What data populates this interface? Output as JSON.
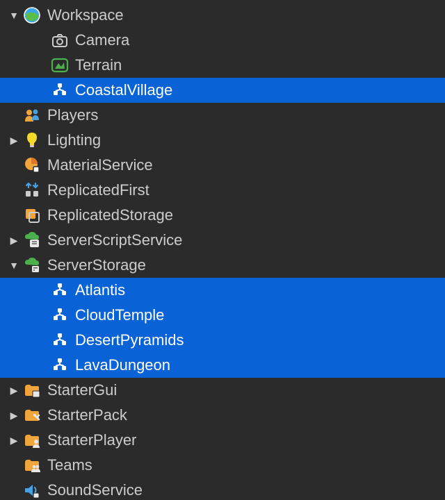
{
  "tree": {
    "workspace": {
      "label": "Workspace"
    },
    "camera": {
      "label": "Camera"
    },
    "terrain": {
      "label": "Terrain"
    },
    "coastal": {
      "label": "CoastalVillage"
    },
    "players": {
      "label": "Players"
    },
    "lighting": {
      "label": "Lighting"
    },
    "material": {
      "label": "MaterialService"
    },
    "repfirst": {
      "label": "ReplicatedFirst"
    },
    "repstorage": {
      "label": "ReplicatedStorage"
    },
    "sss": {
      "label": "ServerScriptService"
    },
    "serverstorage": {
      "label": "ServerStorage"
    },
    "atlantis": {
      "label": "Atlantis"
    },
    "cloudtemple": {
      "label": "CloudTemple"
    },
    "desert": {
      "label": "DesertPyramids"
    },
    "lava": {
      "label": "LavaDungeon"
    },
    "startergui": {
      "label": "StarterGui"
    },
    "starterpack": {
      "label": "StarterPack"
    },
    "starterplayer": {
      "label": "StarterPlayer"
    },
    "teams": {
      "label": "Teams"
    },
    "soundservice": {
      "label": "SoundService"
    }
  },
  "colors": {
    "selected": "#0a63d6",
    "background": "#2b2b2b"
  }
}
